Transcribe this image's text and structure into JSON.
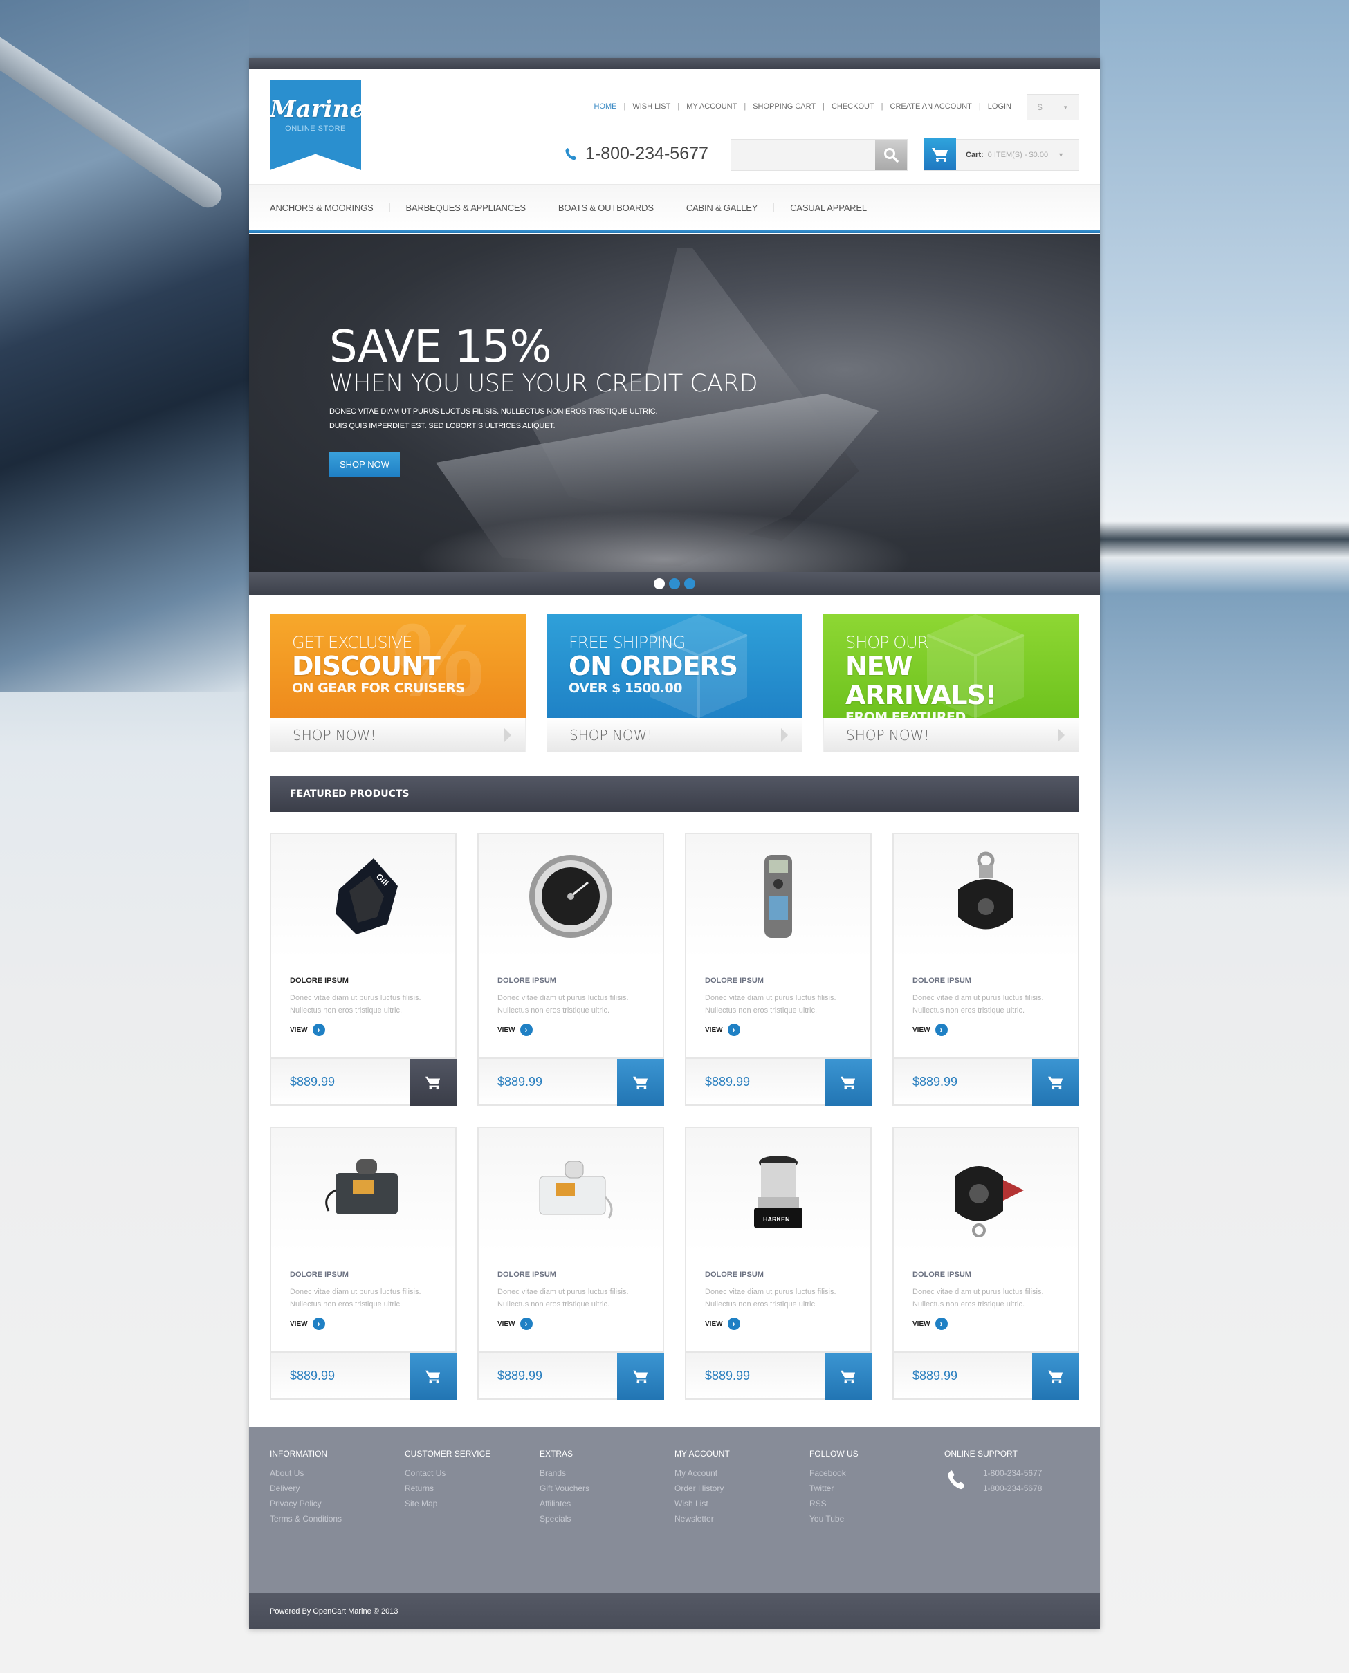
{
  "header": {
    "logo": {
      "name": "Marine",
      "tagline": "ONLINE STORE"
    },
    "top_links": [
      {
        "label": "HOME",
        "active": true
      },
      {
        "label": "WISH LIST",
        "active": false
      },
      {
        "label": "MY ACCOUNT",
        "active": false
      },
      {
        "label": "SHOPPING CART",
        "active": false
      },
      {
        "label": "CHECKOUT",
        "active": false
      },
      {
        "label": "CREATE AN ACCOUNT",
        "active": false
      },
      {
        "label": "LOGIN",
        "active": false
      }
    ],
    "currency": {
      "selected": "$",
      "icon": "chevron-down-icon"
    },
    "phone": {
      "number": "1-800-234-5677",
      "icon": "phone-icon"
    },
    "search": {
      "value": "",
      "placeholder": "",
      "icon": "search-icon"
    },
    "cart": {
      "label": "Cart:",
      "summary": "0 ITEM(S) - $0.00",
      "icon": "cart-icon"
    }
  },
  "nav": {
    "items": [
      {
        "label": "ANCHORS & MOORINGS"
      },
      {
        "label": "BARBEQUES & APPLIANCES"
      },
      {
        "label": "BOATS & OUTBOARDS"
      },
      {
        "label": "CABIN & GALLEY"
      },
      {
        "label": "CASUAL APPAREL"
      }
    ]
  },
  "slider": {
    "headline": "SAVE 15%",
    "subheadline": "WHEN YOU USE YOUR CREDIT CARD",
    "body_line1": "DONEC VITAE DIAM UT PURUS LUCTUS FILISIS. NULLECTUS NON EROS TRISTIQUE ULTRIC.",
    "body_line2": "DUIS QUIS IMPERDIET EST. SED LOBORTIS ULTRICES ALIQUET.",
    "button": "SHOP NOW",
    "slides_total": 3,
    "active_slide": 1
  },
  "banners": [
    {
      "line1": "GET EXCLUSIVE",
      "line2": "DISCOUNT",
      "line3": "ON GEAR FOR CRUISERS",
      "cta": "SHOP NOW!",
      "color": "#f29a22",
      "deco": "%"
    },
    {
      "line1": "FREE SHIPPING",
      "line2": "ON ORDERS",
      "line3": "OVER $ 1500.00",
      "cta": "SHOP NOW!",
      "color": "#2790d0",
      "deco": "box"
    },
    {
      "line1": "SHOP OUR",
      "line2": "NEW ARRIVALS!",
      "line3": "FROM FEATURED COLLECTIONS",
      "cta": "SHOP NOW!",
      "color": "#7ccb27",
      "deco": "box"
    }
  ],
  "featured": {
    "heading": "FEATURED PRODUCTS",
    "products": [
      {
        "title": "DOLORE IPSUM",
        "desc": "Donec vitae diam ut purus luctus filisis. Nullectus non eros tristique ultric.",
        "view": "VIEW",
        "price": "$889.99",
        "image": "knee-pad"
      },
      {
        "title": "DOLORE IPSUM",
        "desc": "Donec vitae diam ut purus luctus filisis. Nullectus non eros tristique ultric.",
        "view": "VIEW",
        "price": "$889.99",
        "image": "gauge"
      },
      {
        "title": "DOLORE IPSUM",
        "desc": "Donec vitae diam ut purus luctus filisis. Nullectus non eros tristique ultric.",
        "view": "VIEW",
        "price": "$889.99",
        "image": "gps"
      },
      {
        "title": "DOLORE IPSUM",
        "desc": "Donec vitae diam ut purus luctus filisis. Nullectus non eros tristique ultric.",
        "view": "VIEW",
        "price": "$889.99",
        "image": "pulley-block"
      },
      {
        "title": "DOLORE IPSUM",
        "desc": "Donec vitae diam ut purus luctus filisis. Nullectus non eros tristique ultric.",
        "view": "VIEW",
        "price": "$889.99",
        "image": "vhf-radio-dark"
      },
      {
        "title": "DOLORE IPSUM",
        "desc": "Donec vitae diam ut purus luctus filisis. Nullectus non eros tristique ultric.",
        "view": "VIEW",
        "price": "$889.99",
        "image": "vhf-radio-white"
      },
      {
        "title": "DOLORE IPSUM",
        "desc": "Donec vitae diam ut purus luctus filisis. Nullectus non eros tristique ultric.",
        "view": "VIEW",
        "price": "$889.99",
        "image": "winch"
      },
      {
        "title": "DOLORE IPSUM",
        "desc": "Donec vitae diam ut purus luctus filisis. Nullectus non eros tristique ultric.",
        "view": "VIEW",
        "price": "$889.99",
        "image": "pulley-block-2"
      }
    ]
  },
  "footer": {
    "columns": [
      {
        "heading": "INFORMATION",
        "links": [
          "About Us",
          "Delivery",
          "Privacy Policy",
          "Terms & Conditions"
        ]
      },
      {
        "heading": "CUSTOMER SERVICE",
        "links": [
          "Contact Us",
          "Returns",
          "Site Map"
        ]
      },
      {
        "heading": "EXTRAS",
        "links": [
          "Brands",
          "Gift Vouchers",
          "Affiliates",
          "Specials"
        ]
      },
      {
        "heading": "MY ACCOUNT",
        "links": [
          "My Account",
          "Order History",
          "Wish List",
          "Newsletter"
        ]
      },
      {
        "heading": "FOLLOW US",
        "links": [
          "Facebook",
          "Twitter",
          "RSS",
          "You Tube"
        ]
      }
    ],
    "support": {
      "heading": "ONLINE SUPPORT",
      "phones": [
        "1-800-234-5677",
        "1-800-234-5678"
      ],
      "icon": "phone-icon"
    },
    "copyright": "Powered By OpenCart Marine © 2013"
  },
  "colors": {
    "accent": "#2a8fcf",
    "dark": "#454954",
    "footer": "#878c98",
    "price": "#2a7fbf"
  }
}
